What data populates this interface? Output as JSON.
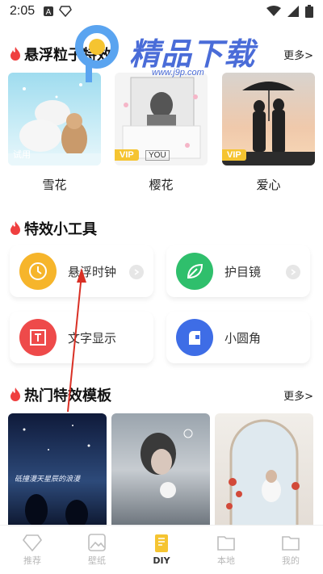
{
  "status_bar": {
    "time": "2:05"
  },
  "particles": {
    "title": "悬浮粒子特效",
    "more": "更多>",
    "items": [
      {
        "label": "雪花",
        "tag": "试用"
      },
      {
        "label": "樱花",
        "badge": "VIP",
        "card_text": "YOU"
      },
      {
        "label": "爱心",
        "badge": "VIP"
      }
    ]
  },
  "tools": {
    "title": "特效小工具",
    "items": [
      {
        "label": "悬浮时钟",
        "icon": "clock-icon",
        "color": "#f6b52b"
      },
      {
        "label": "护目镜",
        "icon": "leaf-icon",
        "color": "#2fbf6c"
      },
      {
        "label": "文字显示",
        "icon": "text-box-icon",
        "color": "#ee4a4a"
      },
      {
        "label": "小圆角",
        "icon": "rounded-corner-icon",
        "color": "#3e6de6"
      }
    ]
  },
  "templates": {
    "title": "热门特效模板",
    "more": "更多>",
    "items": [
      {
        "card_text": "砥撞漫天星辰的浪漫"
      },
      {
        "card_text": ""
      },
      {
        "card_text": ""
      }
    ]
  },
  "tabbar": {
    "items": [
      {
        "label": "推荐",
        "icon": "diamond-icon",
        "active": false
      },
      {
        "label": "壁纸",
        "icon": "picture-icon",
        "active": false
      },
      {
        "label": "DIY",
        "icon": "diy-pencil-icon",
        "active": true
      },
      {
        "label": "本地",
        "icon": "folder-icon",
        "active": false
      },
      {
        "label": "我的",
        "icon": "folder-icon",
        "active": false
      }
    ]
  },
  "watermark": {
    "text": "精品下载",
    "url": "www.j9p.com"
  },
  "colors": {
    "accent": "#f5c431",
    "flame": "#ef3f3f",
    "watermark": "#4a6cd8"
  }
}
